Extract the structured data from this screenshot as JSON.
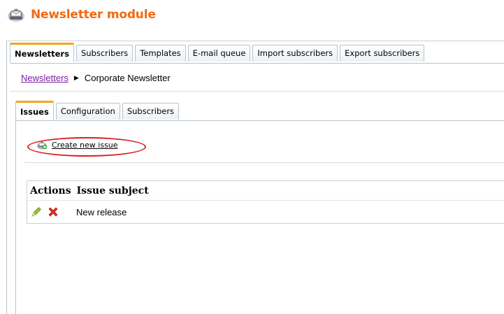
{
  "header": {
    "title": "Newsletter module",
    "icon": "newsletter-icon"
  },
  "top_tabs": [
    {
      "label": "Newsletters",
      "active": true
    },
    {
      "label": "Subscribers",
      "active": false
    },
    {
      "label": "Templates",
      "active": false
    },
    {
      "label": "E-mail queue",
      "active": false
    },
    {
      "label": "Import subscribers",
      "active": false
    },
    {
      "label": "Export subscribers",
      "active": false
    }
  ],
  "breadcrumb": {
    "link": "Newsletters",
    "current": "Corporate Newsletter"
  },
  "sub_tabs": [
    {
      "label": "Issues",
      "active": true
    },
    {
      "label": "Configuration",
      "active": false
    },
    {
      "label": "Subscribers",
      "active": false
    }
  ],
  "actions": {
    "create_label": "Create new issue"
  },
  "grid": {
    "columns": [
      "Actions",
      "Issue subject"
    ],
    "rows": [
      {
        "subject": "New release"
      }
    ]
  },
  "colors": {
    "title": "#f26a10",
    "active_tab_accent": "#f4a41c",
    "highlight": "#d92020",
    "link": "#7b1fa2"
  }
}
